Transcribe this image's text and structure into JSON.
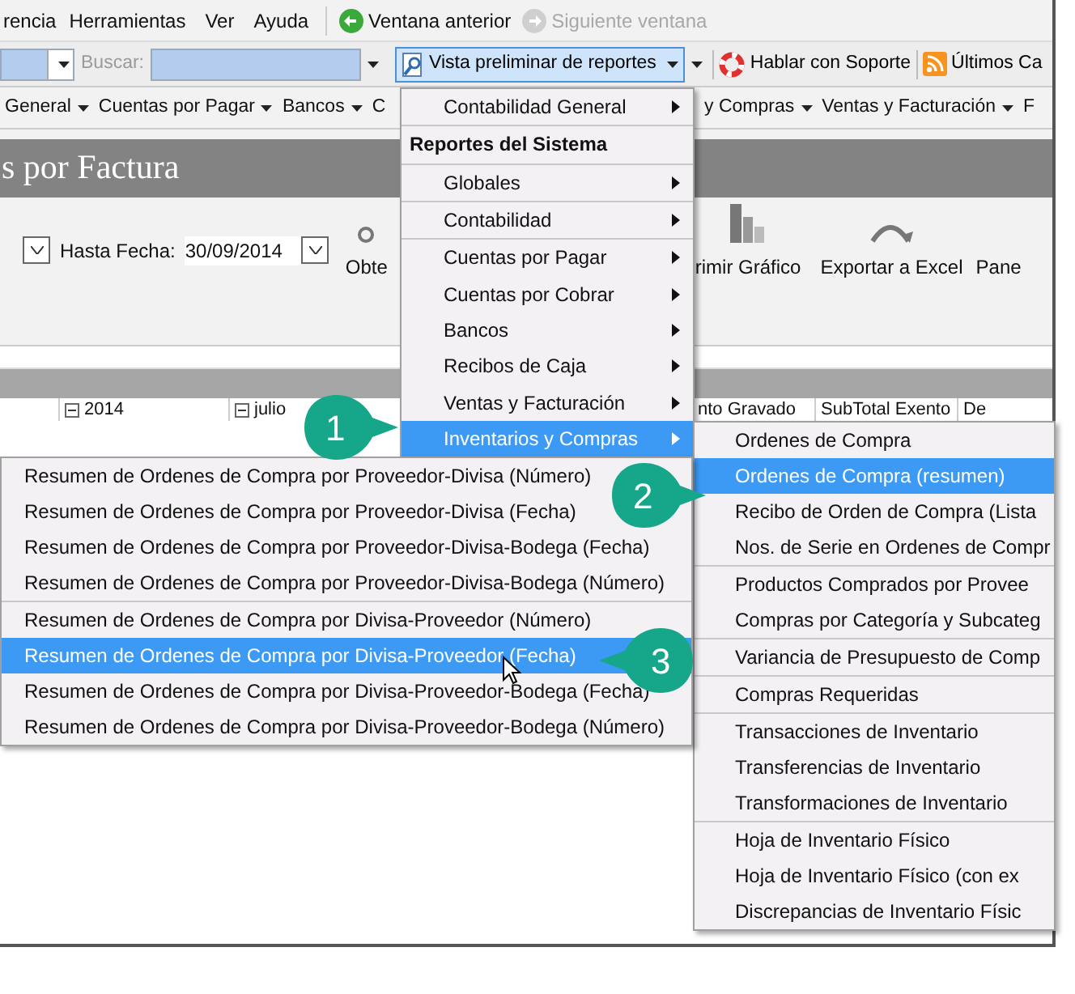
{
  "menubar": {
    "items": [
      "rencia",
      "Herramientas",
      "Ver",
      "Ayuda"
    ],
    "nav_buttons": [
      {
        "label": "Ventana anterior",
        "disabled": false
      },
      {
        "label": "Siguiente ventana",
        "disabled": true
      }
    ]
  },
  "toolbar": {
    "search_label": "Buscar:",
    "search_disabled": true,
    "report_button": "Vista preliminar de reportes",
    "report_open": true,
    "support_button": "Hablar con Soporte",
    "feeds_button": "Últimos Ca"
  },
  "nav_menu_left": [
    "General",
    "Cuentas por Pagar",
    "Bancos",
    "C"
  ],
  "nav_menu_right": [
    "y Compras",
    "Ventas y Facturación",
    "F"
  ],
  "page_title": "s por Factura",
  "ribbon": {
    "date_label": "Hasta Fecha:",
    "date_value": "30/09/2014",
    "buttons": [
      {
        "label": "Obte",
        "kind": "get"
      },
      {
        "label": "rimir Gráfico",
        "kind": "chart"
      },
      {
        "label": "Exportar a Excel",
        "kind": "excel"
      },
      {
        "label": "Pane",
        "kind": "panel"
      }
    ]
  },
  "grid": {
    "headers": [
      "2014",
      "julio",
      "nto Gravado",
      "SubTotal Exento",
      "De"
    ]
  },
  "report_menu": {
    "groups": [
      [
        {
          "label": "Contabilidad General",
          "kind": "item",
          "selected": false
        }
      ],
      [
        {
          "label": "Reportes del Sistema",
          "kind": "header"
        }
      ],
      [
        {
          "label": "Globales",
          "kind": "item",
          "selected": false
        }
      ],
      [
        {
          "label": "Contabilidad",
          "kind": "item",
          "selected": false
        }
      ],
      [
        {
          "label": "Cuentas por Pagar",
          "kind": "item",
          "selected": false
        },
        {
          "label": "Cuentas por Cobrar",
          "kind": "item",
          "selected": false
        },
        {
          "label": "Bancos",
          "kind": "item",
          "selected": false
        },
        {
          "label": "Recibos de Caja",
          "kind": "item",
          "selected": false
        },
        {
          "label": "Ventas y Facturación",
          "kind": "item",
          "selected": false
        },
        {
          "label": "Inventarios y Compras",
          "kind": "item",
          "selected": true
        }
      ]
    ]
  },
  "inventory_menu": {
    "groups": [
      [
        {
          "label": "Ordenes de Compra",
          "selected": false
        },
        {
          "label": "Ordenes de Compra (resumen)",
          "selected": true
        },
        {
          "label": "Recibo de Orden de Compra (Lista",
          "selected": false
        },
        {
          "label": "Nos. de Serie en Ordenes de Compr",
          "selected": false
        }
      ],
      [
        {
          "label": "Productos Comprados por Provee",
          "selected": false
        },
        {
          "label": "Compras por Categoría y Subcateg",
          "selected": false
        }
      ],
      [
        {
          "label": "Variancia de Presupuesto de Comp",
          "selected": false
        }
      ],
      [
        {
          "label": "Compras Requeridas",
          "selected": false
        }
      ],
      [
        {
          "label": "Transacciones de Inventario",
          "selected": false
        },
        {
          "label": "Transferencias de Inventario",
          "selected": false
        },
        {
          "label": "Transformaciones de Inventario",
          "selected": false
        }
      ],
      [
        {
          "label": "Hoja de Inventario Físico",
          "selected": false
        },
        {
          "label": "Hoja de Inventario Físico (con ex",
          "selected": false
        },
        {
          "label": "Discrepancias de Inventario Físic",
          "selected": false
        }
      ]
    ]
  },
  "summary_menu": {
    "groups": [
      [
        {
          "label": "Resumen de Ordenes de Compra por Proveedor-Divisa (Número)",
          "selected": false
        },
        {
          "label": "Resumen de Ordenes de Compra por Proveedor-Divisa (Fecha)",
          "selected": false
        },
        {
          "label": "Resumen de Ordenes de Compra por Proveedor-Divisa-Bodega (Fecha)",
          "selected": false
        },
        {
          "label": "Resumen de Ordenes de Compra por Proveedor-Divisa-Bodega (Número)",
          "selected": false
        }
      ],
      [
        {
          "label": "Resumen de Ordenes de Compra por Divisa-Proveedor (Número)",
          "selected": false
        },
        {
          "label": "Resumen de Ordenes de Compra por Divisa-Proveedor (Fecha)",
          "selected": true
        },
        {
          "label": "Resumen de Ordenes de Compra por Divisa-Proveedor-Bodega (Fecha)",
          "selected": false
        },
        {
          "label": "Resumen de Ordenes de Compra por Divisa-Proveedor-Bodega (Número)",
          "selected": false
        }
      ]
    ]
  },
  "callouts": [
    {
      "text": "1",
      "points_left": false
    },
    {
      "text": "2",
      "points_left": false
    },
    {
      "text": "3",
      "points_left": true
    }
  ]
}
